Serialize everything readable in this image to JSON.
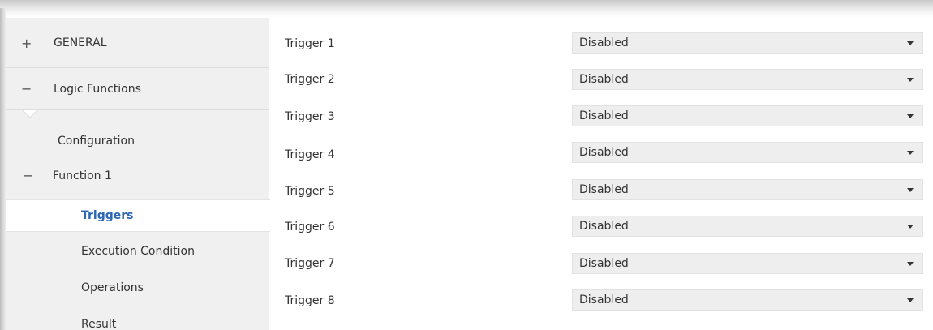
{
  "sidebar": {
    "general": {
      "sign": "+",
      "label": "GENERAL"
    },
    "logic": {
      "sign": "−",
      "label": "Logic Functions"
    },
    "configuration": {
      "label": "Configuration"
    },
    "function1": {
      "sign": "−",
      "label": "Function 1"
    },
    "triggers": {
      "label": "Triggers"
    },
    "execution": {
      "label": "Execution Condition"
    },
    "operations": {
      "label": "Operations"
    },
    "result": {
      "label": "Result"
    }
  },
  "colors": {
    "selected_text": "#2f67b1",
    "sidebar_bg": "#f0f0f0",
    "select_bg": "#eeeeee"
  },
  "icons": {
    "expand": "plus-icon",
    "collapse": "minus-icon",
    "dropdown": "caret-down-icon"
  },
  "triggers": [
    {
      "label": "Trigger 1",
      "value": "Disabled"
    },
    {
      "label": "Trigger 2",
      "value": "Disabled"
    },
    {
      "label": "Trigger 3",
      "value": "Disabled"
    },
    {
      "label": "Trigger 4",
      "value": "Disabled"
    },
    {
      "label": "Trigger 5",
      "value": "Disabled"
    },
    {
      "label": "Trigger 6",
      "value": "Disabled"
    },
    {
      "label": "Trigger 7",
      "value": "Disabled"
    },
    {
      "label": "Trigger 8",
      "value": "Disabled"
    }
  ]
}
